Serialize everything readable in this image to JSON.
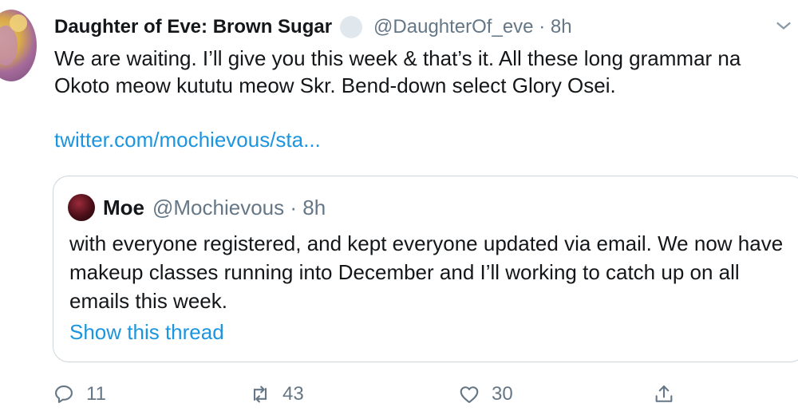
{
  "tweet": {
    "author": {
      "display_name": "Daughter of Eve: Brown Sugar",
      "handle_time": "@DaughterOf_eve · 8h"
    },
    "text_lines": [
      "We are waiting. I’ll give you this week & that’s it. All these long grammar na",
      "Okoto meow kututu meow Skr. Bend-down select Glory Osei."
    ],
    "link": "twitter.com/mochievous/sta..."
  },
  "quote": {
    "name": "Moe",
    "handle_time": "@Mochievous · 8h",
    "text": "with everyone registered, and kept everyone updated via email. We now have makeup classes running into December and I’ll working to catch up on all emails this week.",
    "show_thread": "Show this thread"
  },
  "actions": {
    "reply_count": "11",
    "retweet_count": "43",
    "like_count": "30"
  },
  "colors": {
    "link": "#1b95e0",
    "muted": "#657786",
    "border": "#ccd6dd"
  }
}
